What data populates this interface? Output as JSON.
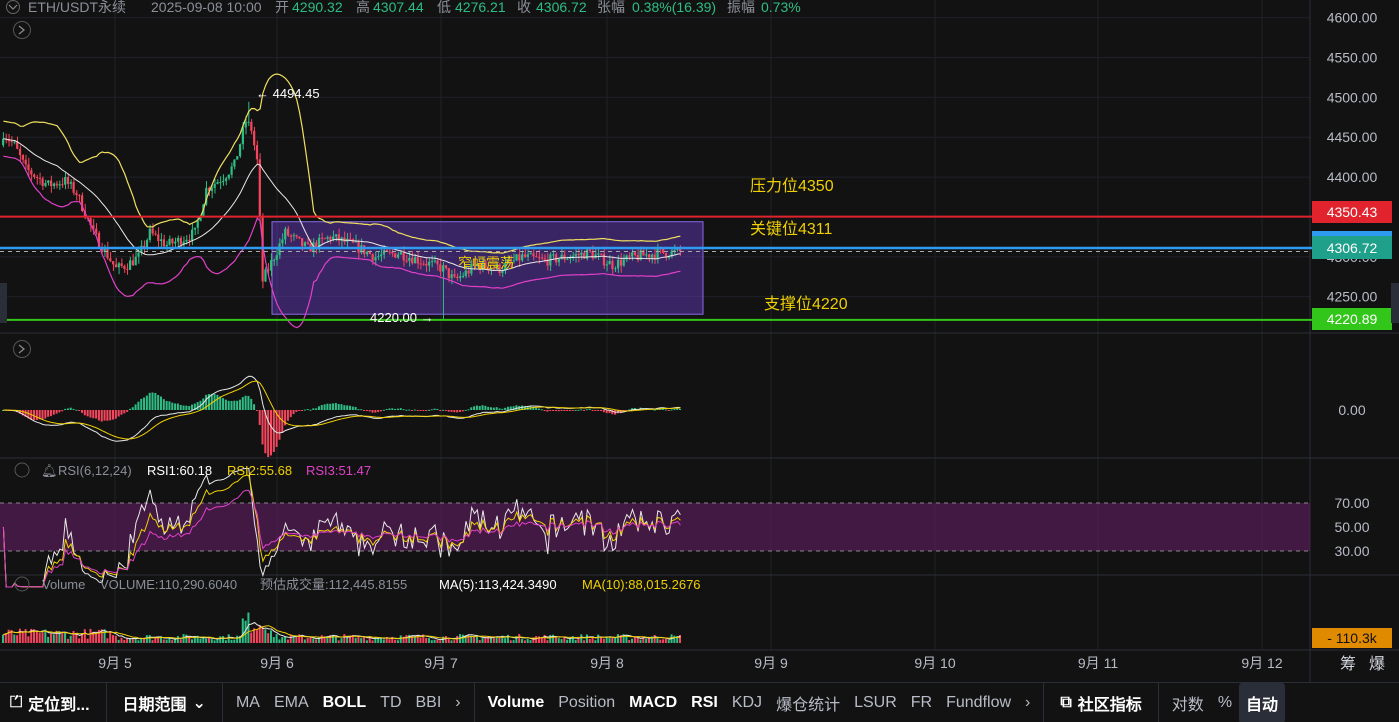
{
  "header": {
    "symbol": "ETH/USDT永续",
    "datetime": "2025-09-08 10:00",
    "open_label": "开",
    "open": "4290.32",
    "high_label": "高",
    "high": "4307.44",
    "low_label": "低",
    "low": "4276.21",
    "close_label": "收",
    "close": "4306.72",
    "change_label": "张幅",
    "change": "0.38%(16.39)",
    "amp_label": "振幅",
    "amp": "0.73%"
  },
  "annotations": {
    "high_marker": "← 4494.45",
    "low_marker": "4220.00 →",
    "resistance": "压力位4350",
    "key": "关键位4311",
    "support": "支撑位4220",
    "box_label": "窄幅震荡"
  },
  "price_tags": {
    "resistance": "4350.43",
    "current": "4306.72",
    "support": "4220.89"
  },
  "rsi_legend": {
    "name": "RSI(6,12,24)",
    "rsi1": "RSI1:60.18",
    "rsi2": "RSI2:55.68",
    "rsi3": "RSI3:51.47"
  },
  "vol_legend": {
    "name": "Volume",
    "volume": "VOLUME:110,290.6040",
    "estimate": "预估成交量:112,445.8155",
    "ma5": "MA(5):113,424.3490",
    "ma10": "MA(10):88,015.2676"
  },
  "vol_tag": "- 110.3k",
  "macd_zero": "0.00",
  "right_bottom": {
    "a": "筹",
    "b": "爆"
  },
  "colors": {
    "up": "#2ebd85",
    "down": "#f6465d",
    "resistance": "#e0232d",
    "key": "#2e9bf0",
    "support": "#33c61a",
    "annotation": "#f0d000",
    "box": "#6a3fc8",
    "rsi_band": "#6a1f6a"
  },
  "toolbar": {
    "locate": "定位到...",
    "range": "日期范围",
    "main_indicators": [
      "MA",
      "EMA",
      "BOLL",
      "TD",
      "BBI"
    ],
    "sub_indicators": [
      "Volume",
      "Position",
      "MACD",
      "RSI",
      "KDJ",
      "爆仓统计",
      "LSUR",
      "FR",
      "Fundflow"
    ],
    "community": "社区指标",
    "log": "对数",
    "pct": "%",
    "auto": "自动"
  },
  "chart_data": {
    "type": "candlestick",
    "interval": "1h",
    "x_ticks": [
      "9月 5",
      "9月 6",
      "9月 7",
      "9月 8",
      "9月 9",
      "9月 10",
      "9月 11",
      "9月 12"
    ],
    "y_ticks": [
      4250,
      4300,
      4350,
      4400,
      4450,
      4500,
      4550,
      4600
    ],
    "y_tick_labels": [
      "4250.00",
      "4300.00",
      "4350.00",
      "4400.00",
      "4450.00",
      "4500.00",
      "4550.00",
      "4600.00"
    ],
    "ylim": [
      4217,
      4612
    ],
    "key_levels": {
      "resistance": 4350.43,
      "key": 4311,
      "current": 4306.72,
      "support": 4220.89
    },
    "extremes": {
      "high": 4494.45,
      "low": 4220.0
    },
    "rsi_ticks": [
      "70.00",
      "50.00",
      "30.00"
    ],
    "rsi_ticks_values": [
      70,
      50,
      30
    ],
    "rsi_values": {
      "rsi1": 60.18,
      "rsi2": 55.68,
      "rsi3": 51.47
    },
    "macd_zero": 0,
    "volume_last": 110290.604
  }
}
